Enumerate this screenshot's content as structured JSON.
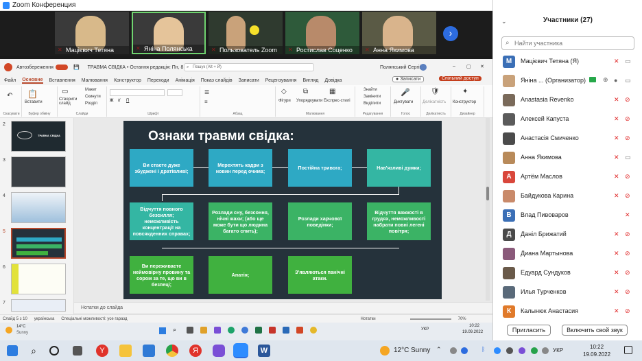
{
  "window": {
    "title": "Zoom Конференция"
  },
  "video_tiles": [
    {
      "name": "Мацієвич Тетяна",
      "face_color": "#d8b98a"
    },
    {
      "name": "Яніна Полянська",
      "face_color": "#e5c49a"
    },
    {
      "name": "Пользователь Zoom",
      "face_color": "#c9a27a"
    },
    {
      "name": "Ростислав Соценко",
      "face_color": "#b88a6a"
    },
    {
      "name": "Анна Якимова",
      "face_color": "#d9b48c"
    }
  ],
  "ppt": {
    "autosave_label": "Автозбереження",
    "doc_title": "ТРАВМА СВІДКА • Остання редакція: Пн, 8:13",
    "search_placeholder": "Пошук (Alt + Й)",
    "user_name": "Полянський Сергій",
    "menu": [
      "Файл",
      "Основне",
      "Вставлення",
      "Малювання",
      "Конструктор",
      "Переходи",
      "Анімація",
      "Показ слайдів",
      "Записати",
      "Рецензування",
      "Вигляд",
      "Довідка"
    ],
    "record_label": "Записати",
    "share_label": "Спільний доступ",
    "ribbon": {
      "paste": "Вставити",
      "create_slide": "Створити слайд",
      "layout": "Макет",
      "reset": "Скинути",
      "section": "Розділ",
      "shapes": "Фігури",
      "arrange": "Упорядкувати",
      "styles": "Експрес-стилі",
      "find": "Знайти",
      "replace": "Замінити",
      "select": "Виділити",
      "dictate": "Диктувати",
      "sensitivity": "Делікатність",
      "designer": "Конструктор",
      "groups": [
        "Скасувати",
        "Буфер обміну",
        "Слайди",
        "Шрифт",
        "Абзац",
        "Малювання",
        "Редагування",
        "Голос",
        "Делікатність",
        "Дизайнер"
      ]
    },
    "slide_numbers": [
      "2",
      "3",
      "4",
      "5",
      "6",
      "7"
    ],
    "thumb_texts": [
      "ТРАВМА СВІДКА"
    ],
    "slide": {
      "title": "Ознаки травми свідка:",
      "boxes": [
        "Ви стаєте дуже збуджені і дратівливі;",
        "Мерехтять кадри з новин перед очима;",
        "Постійна тривога;",
        "Нав'язливі думки;",
        "Відчуття повного безсилля; неможливість концентрації на повсякденних справах;",
        "Розлади сну, безсоння, нічні жахи; (або ще може бути що людина багато спить);",
        "Розлади харчової поведінки;",
        "Відчуття важкості в грудях, неможливості набрати повні легені повітря;",
        "Ви переживаєте неймовірну провину та сором за те, що ви в безпеці;",
        "Апатія;",
        "З'являються панічні атаки."
      ]
    },
    "notes_label": "Нотатки до слайда",
    "status": {
      "slide_of": "Слайд 5 з 10",
      "lang": "українська",
      "accessibility": "Спеціальні можливості: усе гаразд",
      "notes": "Нотатки",
      "zoom": "70%"
    }
  },
  "inner_taskbar": {
    "weather_temp": "14°C",
    "weather_desc": "Sunny",
    "lang": "УКР",
    "time": "10:22",
    "date": "19.09.2022"
  },
  "participants": {
    "header": "Участники (27)",
    "search_placeholder": "Найти участника",
    "list": [
      {
        "initial": "М",
        "color": "#3b6fb6",
        "name": "Мацієвич Тетяна (Я)"
      },
      {
        "initial": "",
        "color": "#c9a27a",
        "name": "Яніна ... (Организатор)"
      },
      {
        "initial": "",
        "color": "#7a6a5a",
        "name": "Anastasia Revenko"
      },
      {
        "initial": "",
        "color": "#5b5b5b",
        "name": "Алексей Капуста"
      },
      {
        "initial": "",
        "color": "#4b4b4b",
        "name": "Анастасія Смиченко"
      },
      {
        "initial": "",
        "color": "#b88a5a",
        "name": "Анна Якимова"
      },
      {
        "initial": "А",
        "color": "#d9473b",
        "name": "Артём Маслов"
      },
      {
        "initial": "",
        "color": "#c98a6a",
        "name": "Байдукова Карина"
      },
      {
        "initial": "В",
        "color": "#3b6fb6",
        "name": "Влад Пивоваров"
      },
      {
        "initial": "Д",
        "color": "#4a4a4a",
        "name": "Даніл Брижатий"
      },
      {
        "initial": "",
        "color": "#8a5a7a",
        "name": "Диана Мартынова"
      },
      {
        "initial": "",
        "color": "#6a5a4a",
        "name": "Едуард Сундуков"
      },
      {
        "initial": "",
        "color": "#5a6a7a",
        "name": "Илья Турченков"
      },
      {
        "initial": "К",
        "color": "#e07a2a",
        "name": "Калынюк Анастасия"
      }
    ],
    "invite_label": "Пригласить",
    "unmute_label": "Включить свой звук"
  },
  "taskbar": {
    "weather_temp": "12°C",
    "weather_desc": "Sunny",
    "lang": "УКР",
    "time": "10:22",
    "date": "19.09.2022"
  }
}
